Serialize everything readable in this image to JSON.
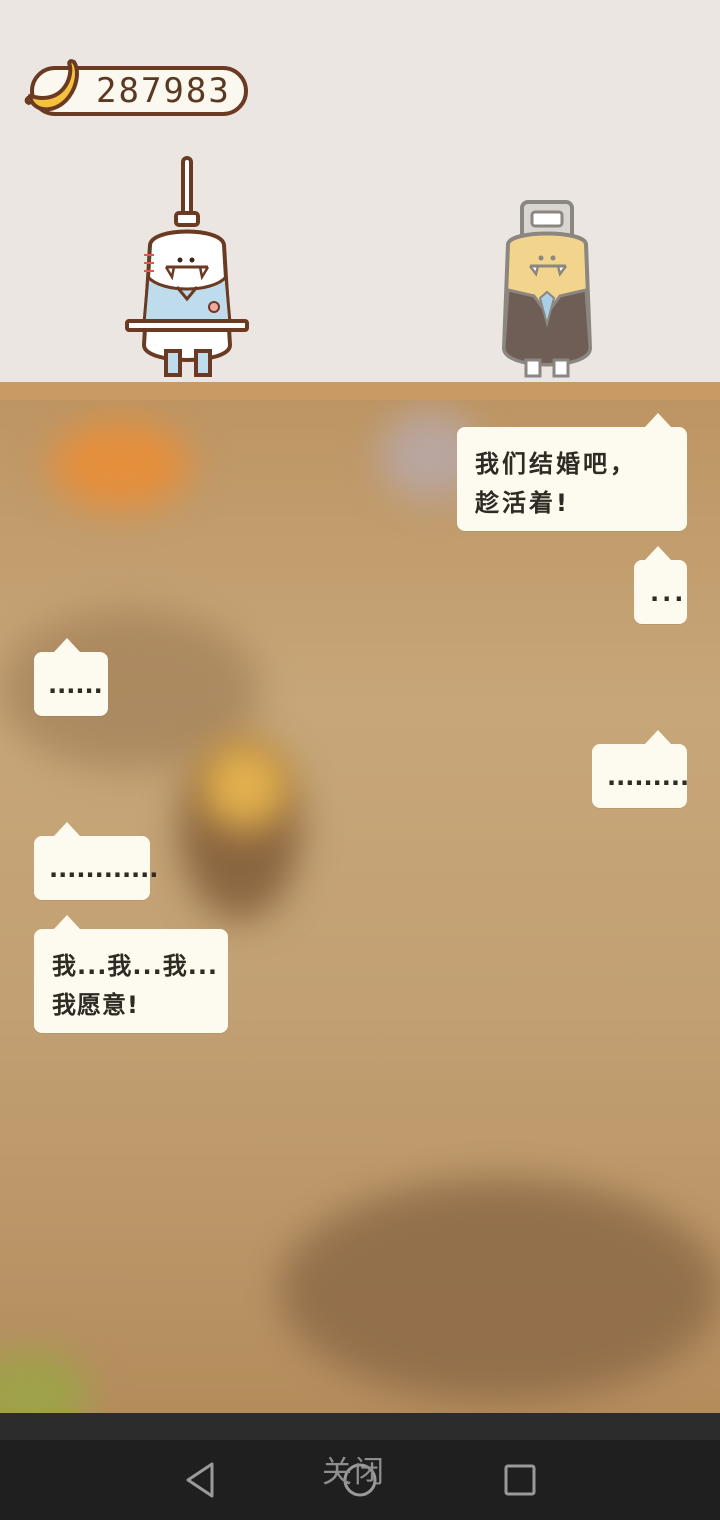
{
  "hud": {
    "banana_count": "287983",
    "icon": "banana-icon"
  },
  "characters": [
    {
      "name": "syringe-character",
      "role": "left"
    },
    {
      "name": "robot-suit-character",
      "role": "right"
    }
  ],
  "dialogue": [
    {
      "speaker": "right",
      "text": "我们结婚吧，\n趁活着!"
    },
    {
      "speaker": "right",
      "text": "..."
    },
    {
      "speaker": "left",
      "text": "......"
    },
    {
      "speaker": "right",
      "text": "........."
    },
    {
      "speaker": "left",
      "text": "............"
    },
    {
      "speaker": "left",
      "text": "我...我...我...\n我愿意!"
    }
  ],
  "system_nav": {
    "close_label": "关闭",
    "back_icon": "back-triangle-icon",
    "home_icon": "home-circle-icon",
    "recents_icon": "recents-square-icon"
  },
  "colors": {
    "bubble": "#fdfbef",
    "shelf": "#c99a63",
    "background": "#ebe6e1",
    "outline": "#6b3a22"
  }
}
